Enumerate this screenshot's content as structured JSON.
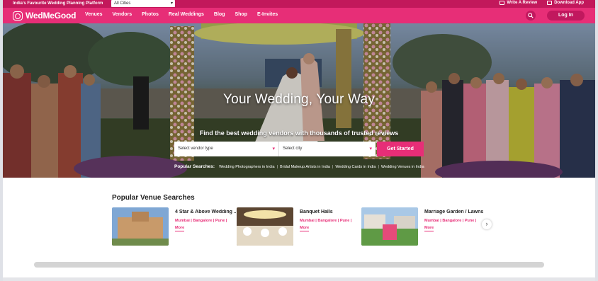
{
  "topbar": {
    "tagline": "India's Favourite Wedding Planning Platform",
    "city_select": "All Cities",
    "write_review": "Write A Review",
    "download_app": "Download App"
  },
  "nav": {
    "logo": "WedMeGood",
    "links": [
      "Venues",
      "Vendors",
      "Photos",
      "Real Weddings",
      "Blog",
      "Shop",
      "E-Invites"
    ],
    "login": "Log In"
  },
  "hero": {
    "title": "Your Wedding, Your Way",
    "subtitle": "Find the best wedding vendors with thousands of trusted reviews",
    "vendor_placeholder": "Select vendor type",
    "city_placeholder": "Select city",
    "cta": "Get Started",
    "popular_label": "Popular Searches:",
    "popular_items": [
      "Wedding Photographers in India",
      "Bridal Makeup Artists in India",
      "Wedding Cards in India",
      "Wedding Venues in India"
    ]
  },
  "venues": {
    "title": "Popular Venue Searches",
    "cards": [
      {
        "name": "4 Star & Above Wedding ...",
        "cities": "Mumbai | Bangalore | Pune |",
        "more": "More"
      },
      {
        "name": "Banquet Halls",
        "cities": "Mumbai | Bangalore | Pune |",
        "more": "More"
      },
      {
        "name": "Marriage Garden / Lawns",
        "cities": "Mumbai | Bangalore | Pune |",
        "more": "More"
      }
    ]
  },
  "colors": {
    "brand": "#e72e77",
    "brand_dark": "#c2185b"
  }
}
